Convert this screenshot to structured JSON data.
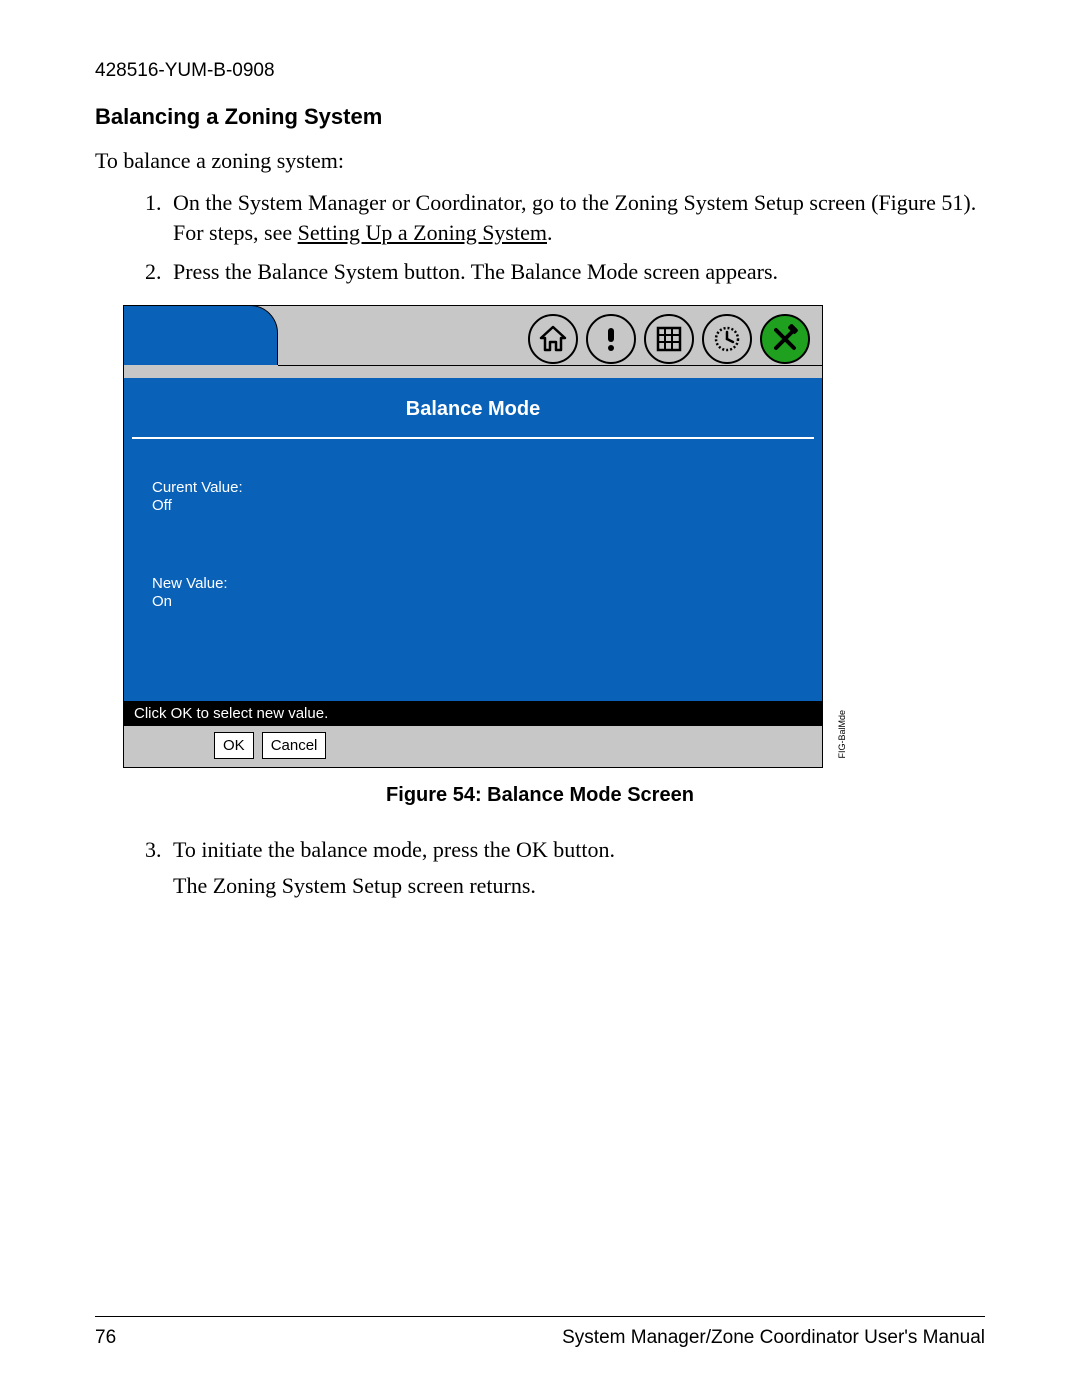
{
  "header": {
    "doc_id": "428516-YUM-B-0908",
    "section_title": "Balancing a Zoning System",
    "intro": "To balance a zoning system:"
  },
  "steps": {
    "s1_a": "On the System Manager or Coordinator, go to the Zoning System Setup screen (Figure 51). For steps, see ",
    "s1_link": "Setting Up a Zoning System",
    "s1_b": ".",
    "s2": "Press the Balance System button. The Balance Mode screen appears.",
    "s3": "To initiate the balance mode, press the OK button.",
    "s3_follow": "The Zoning System Setup screen returns."
  },
  "figure": {
    "caption": "Figure 54: Balance Mode Screen",
    "side_label": "FIG-BalMde"
  },
  "device": {
    "title": "Balance Mode",
    "current_label": "Curent Value:",
    "current_value": "Off",
    "new_label": "New Value:",
    "new_value": "On",
    "footer_hint": "Click OK to select new value.",
    "ok_label": "OK",
    "cancel_label": "Cancel",
    "toolbar": {
      "home": "home-icon",
      "alert": "alert-icon",
      "keypad": "keypad-icon",
      "schedule": "schedule-icon",
      "tools": "tools-icon"
    }
  },
  "footer": {
    "page_number": "76",
    "manual_title": "System Manager/Zone Coordinator User's Manual"
  }
}
